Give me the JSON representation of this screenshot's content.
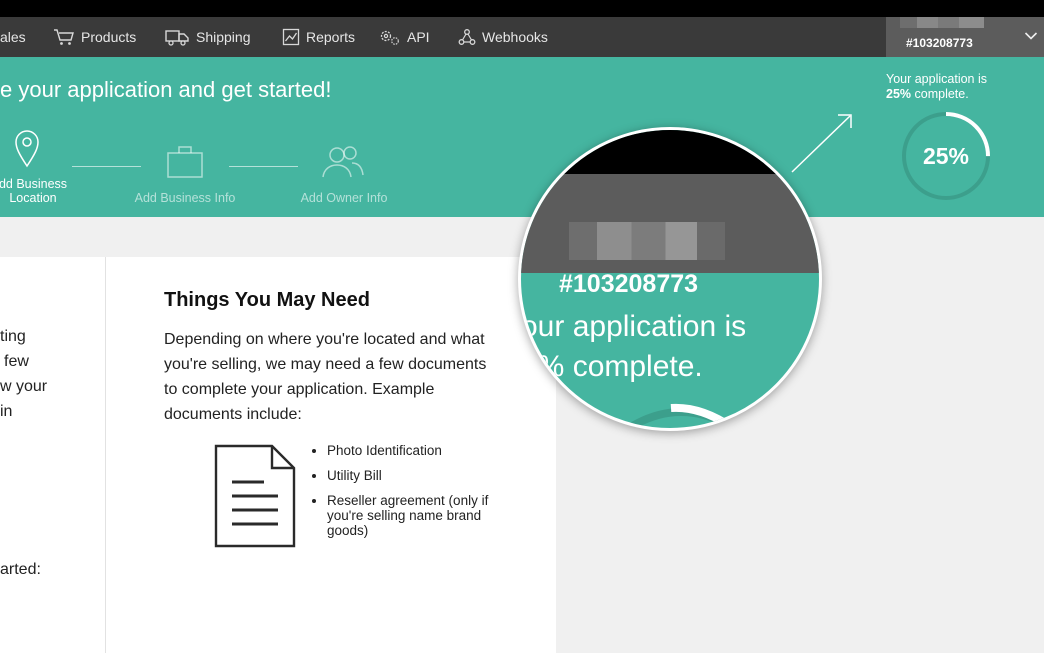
{
  "nav": {
    "items": [
      {
        "label": "ales",
        "icon": "none"
      },
      {
        "label": "Products",
        "icon": "cart-icon"
      },
      {
        "label": "Shipping",
        "icon": "truck-icon"
      },
      {
        "label": "Reports",
        "icon": "chart-icon"
      },
      {
        "label": "API",
        "icon": "gears-icon"
      },
      {
        "label": "Webhooks",
        "icon": "webhook-icon"
      }
    ],
    "account_number": "#103208773"
  },
  "banner": {
    "title": "e your application and get started!",
    "steps": [
      {
        "label_line1": "dd Business",
        "label_line2": "Location",
        "icon": "map-pin-icon"
      },
      {
        "label_line1": "Add Business Info",
        "label_line2": "",
        "icon": "briefcase-icon"
      },
      {
        "label_line1": "Add Owner Info",
        "label_line2": "",
        "icon": "users-icon"
      }
    ],
    "progress": {
      "line1": "Your application is",
      "percent_label": "25%",
      "line2_suffix": " complete.",
      "ring_label": "25%",
      "percent": 25
    }
  },
  "left_card": {
    "fragments": [
      "ting",
      "few",
      "w your",
      "in",
      "arted:"
    ]
  },
  "right_card": {
    "title": "Things You May Need",
    "body": "Depending on where you're located and what you're selling, we may need a few documents to complete your application. Example documents include:",
    "documents": [
      "Photo Identification",
      "Utility Bill",
      "Reseller agreement (only if you're selling name brand goods)"
    ]
  },
  "magnifier": {
    "account_number": "#103208773",
    "line1": "our application is",
    "line2": "5% complete."
  },
  "colors": {
    "teal": "#45b5a0",
    "nav_bg": "#3a3a3a",
    "account_bg": "#5c5c5c"
  }
}
